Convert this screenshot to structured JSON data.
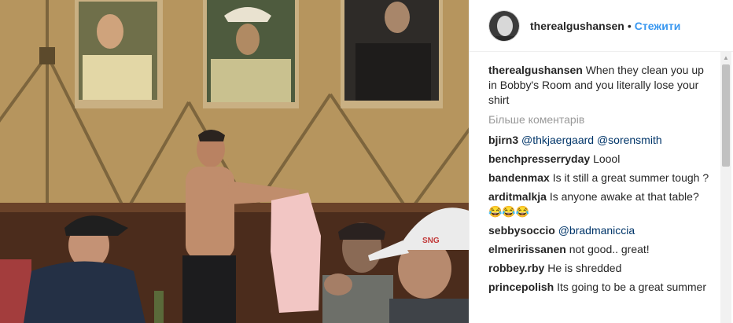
{
  "photo": {
    "description_icon": "photo",
    "cap_logo": "SNG"
  },
  "header": {
    "username": "therealgushansen",
    "separator": "•",
    "follow_label": "Стежити"
  },
  "caption": {
    "username": "therealgushansen",
    "text": "When they clean you up in Bobby's Room and you literally lose your shirt"
  },
  "more_comments_label": "Більше коментарів",
  "comments": [
    {
      "user": "bjirn3",
      "mention1": "@thkjaergaard",
      "mention2": "@sorensmith",
      "text": ""
    },
    {
      "user": "benchpresserryday",
      "text": "Loool"
    },
    {
      "user": "bandenmax",
      "text": "Is it still a great summer tough ?"
    },
    {
      "user": "arditmalkja",
      "text": "Is anyone awake at that table? 😂😂😂"
    },
    {
      "user": "sebbysoccio",
      "mention1": "@bradmaniccia",
      "text": ""
    },
    {
      "user": "elmeririssanen",
      "text": "not good.. great!"
    },
    {
      "user": "robbey.rby",
      "text": "He is shredded"
    },
    {
      "user": "princepolish",
      "text": "Its going to be a great summer"
    }
  ],
  "colors": {
    "link": "#3897f0",
    "mention": "#003569",
    "muted": "#999999"
  }
}
